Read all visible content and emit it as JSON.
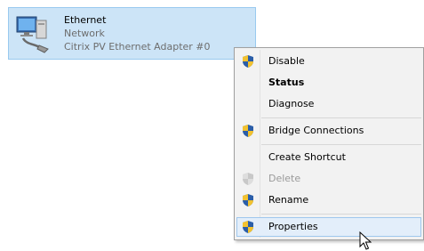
{
  "adapter": {
    "name": "Ethernet",
    "network": "Network",
    "description": "Citrix PV Ethernet Adapter #0",
    "icon": "network-adapter-icon"
  },
  "context_menu": {
    "items": [
      {
        "label": "Disable",
        "shield": true,
        "bold": false,
        "disabled": false
      },
      {
        "label": "Status",
        "shield": false,
        "bold": true,
        "disabled": false
      },
      {
        "label": "Diagnose",
        "shield": false,
        "bold": false,
        "disabled": false
      },
      {
        "label": "Bridge Connections",
        "shield": true,
        "bold": false,
        "disabled": false
      },
      {
        "label": "Create Shortcut",
        "shield": false,
        "bold": false,
        "disabled": false
      },
      {
        "label": "Delete",
        "shield": true,
        "bold": false,
        "disabled": true
      },
      {
        "label": "Rename",
        "shield": true,
        "bold": false,
        "disabled": false
      },
      {
        "label": "Properties",
        "shield": true,
        "bold": false,
        "disabled": false,
        "hovered": true
      }
    ]
  },
  "colors": {
    "selection": "#cce4f7",
    "hover": "#e3eefa",
    "menu_bg": "#f2f2f2",
    "shield_blue": "#2b5ea8",
    "shield_yellow": "#f2c230"
  }
}
